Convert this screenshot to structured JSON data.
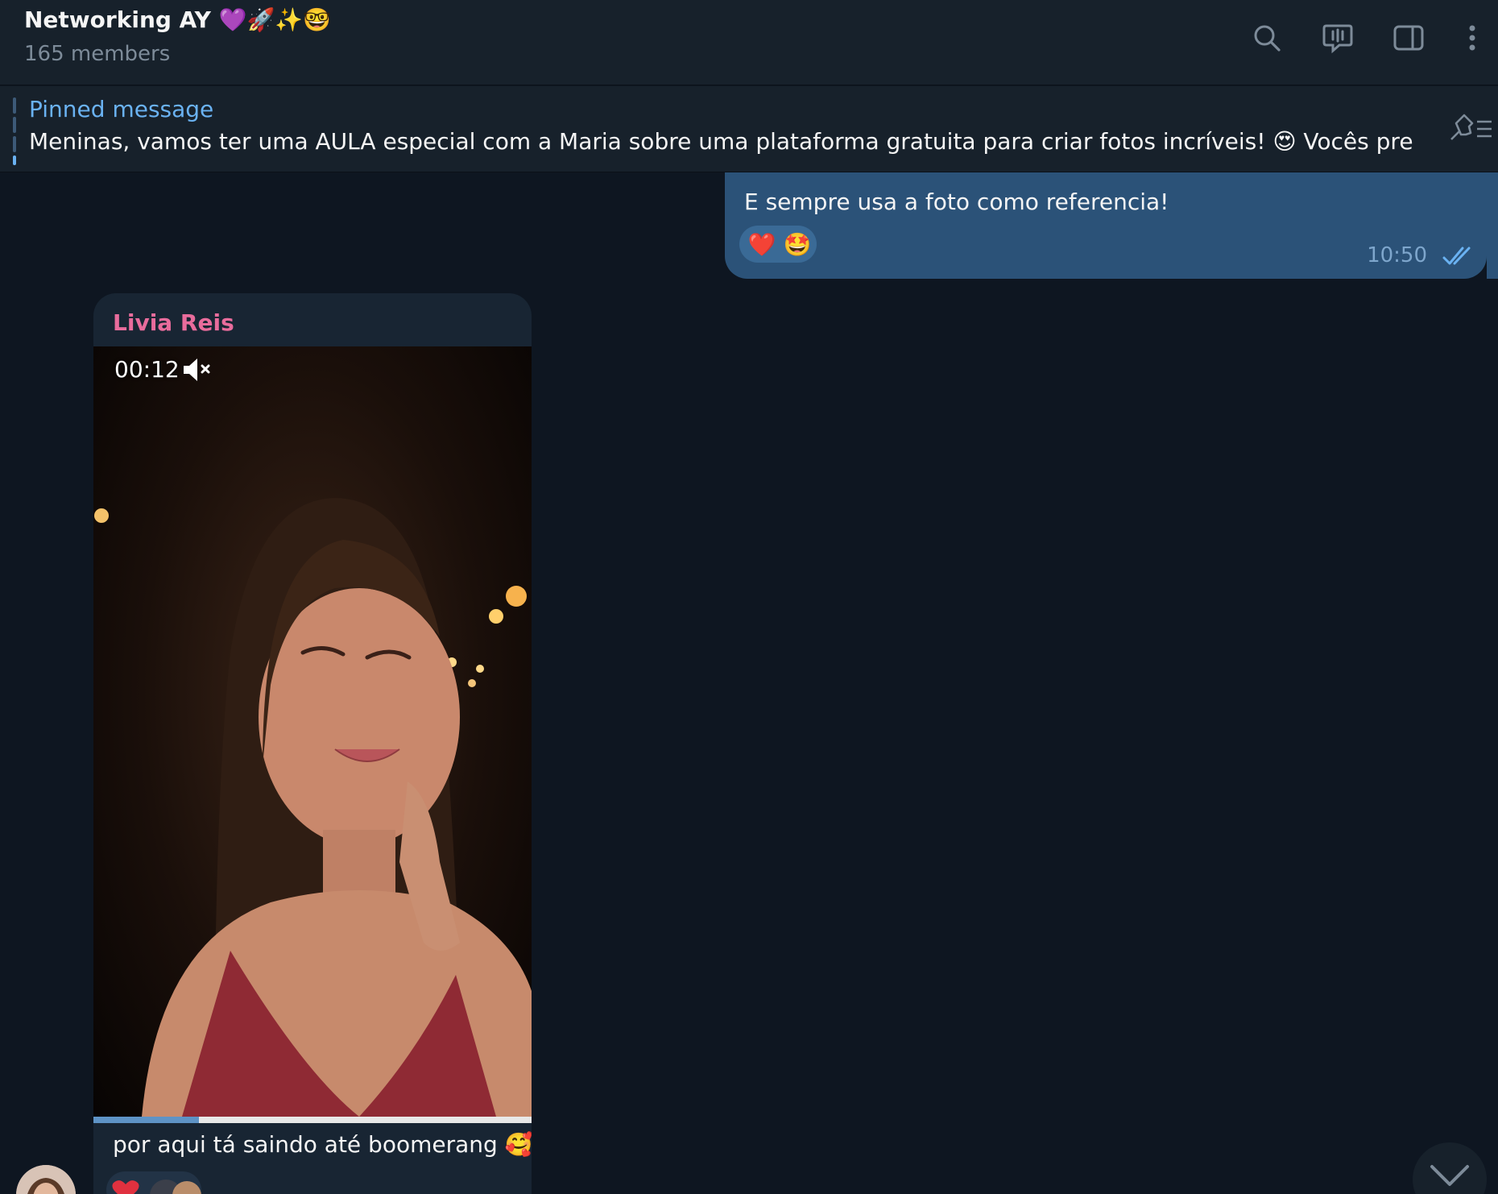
{
  "header": {
    "title": "Networking AY 💜🚀✨🤓",
    "subtitle": "165 members",
    "icons": [
      "search-icon",
      "video-chat-icon",
      "sidebar-toggle-icon",
      "more-options-icon"
    ]
  },
  "pinned": {
    "label": "Pinned message",
    "text": "Meninas, vamos ter uma AULA especial com a Maria  sobre uma plataforma gratuita para criar fotos incríveis! 😍  Vocês precisam..."
  },
  "messages": {
    "outgoing": {
      "text": "E sempre usa a foto como referencia!",
      "reactions": [
        "❤️",
        "🤩"
      ],
      "time": "10:50",
      "status": "read"
    },
    "incoming": {
      "sender": "Livia Reis",
      "media_time": "00:12",
      "muted": true,
      "progress": 0.24,
      "caption": "por aqui tá saindo até boomerang 🥰"
    }
  },
  "colors": {
    "background": "#0e1621",
    "header": "#17212b",
    "outgoing_bubble": "#2b5278",
    "incoming_bubble": "#182533",
    "accent": "#6ab2f2",
    "sender_name": "#e86c9c"
  }
}
